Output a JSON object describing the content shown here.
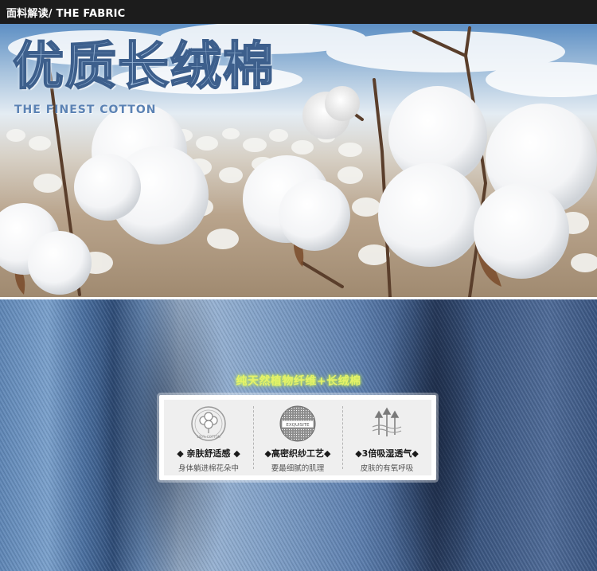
{
  "header": {
    "title": "面料解读/ THE FABRIC"
  },
  "banner": {
    "title": "优质长绒棉",
    "subtitle": "THE FINEST COTTON"
  },
  "denim": {
    "fiber_text": "纯天然植物纤维+长绒棉"
  },
  "features": [
    {
      "icon": "cotton-100-percent-icon",
      "icon_text": "100% COTTON",
      "title": "◆ 亲肤舒适感 ◆",
      "desc": "身体躺进棉花朵中"
    },
    {
      "icon": "exquisite-badge-icon",
      "icon_text": "EXQUISITE",
      "title": "◆高密织纱工艺◆",
      "desc": "要最细腻的肌理"
    },
    {
      "icon": "moisture-wicking-arrows-icon",
      "title": "◆3倍吸湿透气◆",
      "desc": "皮肤的有氧呼吸"
    }
  ]
}
